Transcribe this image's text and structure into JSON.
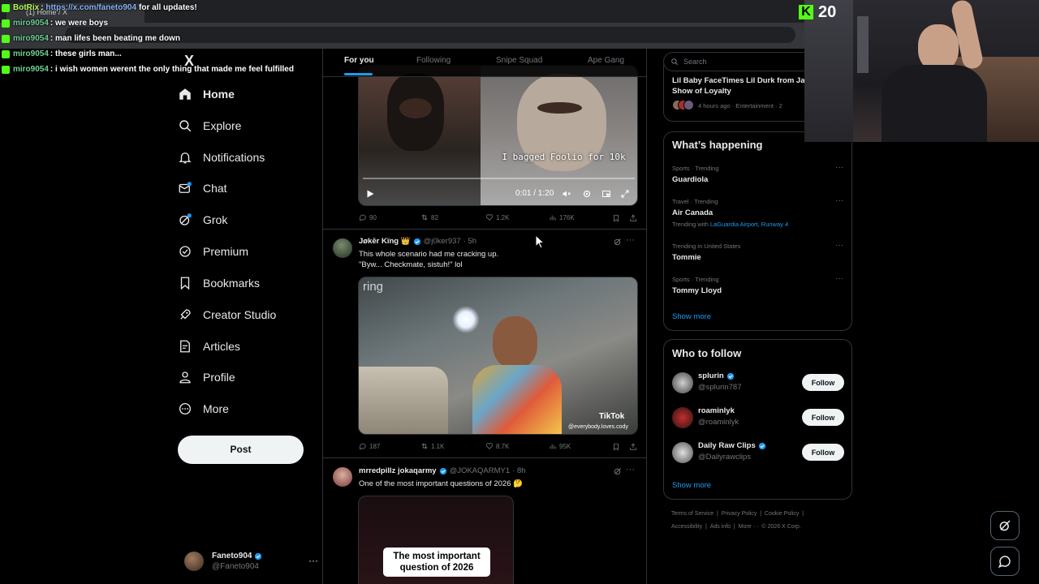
{
  "browser": {
    "tab_title": "(1) Home / X"
  },
  "chat": [
    {
      "user": "BotRix",
      "bot": true,
      "link": "https://x.com/faneto904",
      "message": "for all updates!"
    },
    {
      "user": "miro9054",
      "message": ": we were boys"
    },
    {
      "user": "miro9054",
      "message": ": man lifes been beating me down"
    },
    {
      "user": "miro9054",
      "message": ": these girls man..."
    },
    {
      "user": "miro9054",
      "message": ": i wish women werent the only thing that made me feel fulfilled"
    }
  ],
  "nav": {
    "logo": "X",
    "items": [
      {
        "label": "Home",
        "icon": "home-icon"
      },
      {
        "label": "Explore",
        "icon": "search-icon"
      },
      {
        "label": "Notifications",
        "icon": "bell-icon"
      },
      {
        "label": "Chat",
        "icon": "mail-icon"
      },
      {
        "label": "Grok",
        "icon": "grok-icon"
      },
      {
        "label": "Premium",
        "icon": "verified-icon"
      },
      {
        "label": "Bookmarks",
        "icon": "bookmark-icon"
      },
      {
        "label": "Creator Studio",
        "icon": "rocket-icon"
      },
      {
        "label": "Articles",
        "icon": "article-icon"
      },
      {
        "label": "Profile",
        "icon": "person-icon"
      },
      {
        "label": "More",
        "icon": "more-circle-icon"
      }
    ],
    "post_label": "Post"
  },
  "account": {
    "name": "Faneto904",
    "handle": "@Faneto904",
    "more": "···"
  },
  "tabs": [
    {
      "label": "For you",
      "active": true
    },
    {
      "label": "Following"
    },
    {
      "label": "Snipe Squad"
    },
    {
      "label": "Ape Gang"
    }
  ],
  "posts": [
    {
      "video": {
        "caption": "I bagged Foolio for 10k",
        "time": "0:01 / 1:20"
      },
      "stats": {
        "replies": "90",
        "reposts": "82",
        "likes": "1.2K",
        "views": "176K"
      }
    },
    {
      "name": "Jøkēr Kïng 👑",
      "handle": "@j0ker937",
      "time": "· 5h",
      "text_lines": [
        "This whole scenario had me cracking up.",
        "\"Byw... Checkmate, sistuh!\" lol"
      ],
      "media": {
        "watermark": "ring",
        "tiktok": "TikTok",
        "tiktok_user": "@everybody.loves.cody"
      },
      "stats": {
        "replies": "187",
        "reposts": "1.1K",
        "likes": "8.7K",
        "views": "95K"
      }
    },
    {
      "name": "mrredpillz jokaqarmy",
      "handle": "@JOKAQARMY1",
      "time": "· 8h",
      "text": "One of the most important questions of 2026 🤔",
      "media": {
        "caption_lines": [
          "The most important",
          "question of 2026"
        ]
      }
    }
  ],
  "right": {
    "search_placeholder": "Search",
    "news": {
      "title_lines": [
        "Lil Baby FaceTimes Lil Durk from Ja",
        "Show of Loyalty"
      ],
      "meta": "4 hours ago · Entertainment · 2"
    },
    "whats_happening": {
      "title": "What’s happening",
      "trends": [
        {
          "meta": "Sports · Trending",
          "name": "Guardiola"
        },
        {
          "meta": "Travel · Trending",
          "name": "Air Canada",
          "with_prefix": "Trending with",
          "with_links": "LaGuardia Airport, Runway 4"
        },
        {
          "meta": "Trending in United States",
          "name": "Tommie"
        },
        {
          "meta": "Sports · Trending",
          "name": "Tommy Lloyd"
        }
      ],
      "show_more": "Show more"
    },
    "who_to_follow": {
      "title": "Who to follow",
      "users": [
        {
          "name": "splurin",
          "handle": "@splurin787",
          "verified": true
        },
        {
          "name": "roaminlyk",
          "handle": "@roaminlyk",
          "verified": false
        },
        {
          "name": "Daily Raw Clips",
          "handle": "@Dailyrawclips",
          "verified": true
        }
      ],
      "follow_label": "Follow",
      "show_more": "Show more"
    },
    "footer": {
      "line1": [
        "Terms of Service",
        "|",
        "Privacy Policy",
        "|",
        "Cookie Policy",
        "|"
      ],
      "line2": [
        "Accessibility",
        "|",
        "Ads info",
        "|",
        "More ···",
        "© 2026 X Corp."
      ]
    }
  },
  "kick": {
    "viewers": "20"
  },
  "colors": {
    "accent": "#1d9bf0",
    "kick_green": "#53fc18",
    "border": "#2f3336"
  }
}
